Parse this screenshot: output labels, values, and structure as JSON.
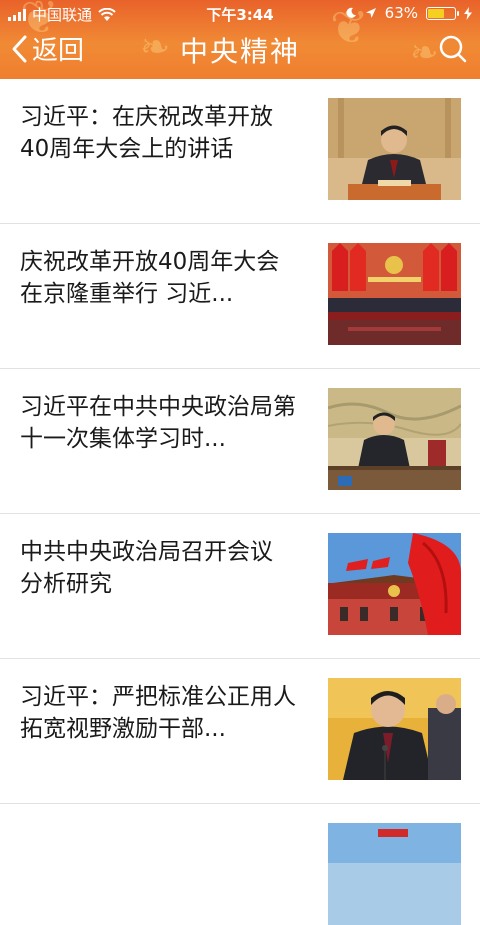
{
  "status_bar": {
    "carrier": "中国联通",
    "time": "下午3:44",
    "battery_percent": "63%",
    "battery_level": 0.63
  },
  "nav": {
    "back_label": "返回",
    "title": "中央精神"
  },
  "articles": [
    {
      "title": "习近平：在庆祝改革开放40周年大会上的讲话"
    },
    {
      "title": "庆祝改革开放40周年大会在京隆重举行 习近..."
    },
    {
      "title": "习近平在中共中央政治局第十一次集体学习时..."
    },
    {
      "title": "中共中央政治局召开会议 分析研究"
    },
    {
      "title": "习近平：严把标准公正用人拓宽视野激励干部..."
    }
  ],
  "colors": {
    "header_top": "#e9622a",
    "header_bottom": "#f08a35"
  }
}
